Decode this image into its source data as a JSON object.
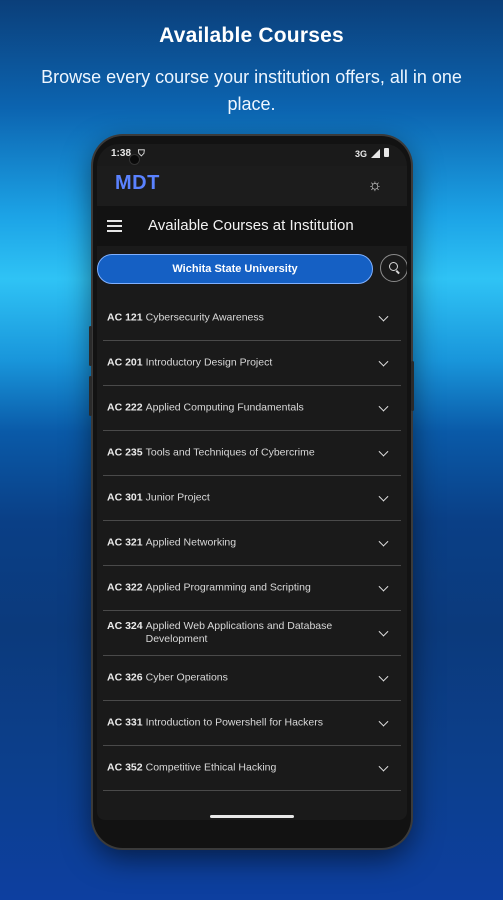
{
  "promo": {
    "title": "Available Courses",
    "subtitle": "Browse every course your institution offers, all in one place."
  },
  "status_bar": {
    "time": "1:38",
    "network": "3G"
  },
  "app_bar": {
    "brand": "MDT",
    "theme_icon": "sun-icon"
  },
  "header": {
    "menu_icon": "menu-icon",
    "title": "Available Courses at Institution"
  },
  "institution": {
    "selected": "Wichita State University"
  },
  "courses": [
    {
      "code": "AC 121",
      "name": "Cybersecurity Awareness"
    },
    {
      "code": "AC 201",
      "name": "Introductory Design Project"
    },
    {
      "code": "AC 222",
      "name": "Applied Computing Fundamentals"
    },
    {
      "code": "AC 235",
      "name": "Tools and Techniques of Cybercrime"
    },
    {
      "code": "AC 301",
      "name": "Junior Project"
    },
    {
      "code": "AC 321",
      "name": "Applied Networking"
    },
    {
      "code": "AC 322",
      "name": "Applied Programming and Scripting"
    },
    {
      "code": "AC 324",
      "name": "Applied Web Applications and Database Development"
    },
    {
      "code": "AC 326",
      "name": "Cyber Operations"
    },
    {
      "code": "AC 331",
      "name": "Introduction to Powershell for Hackers"
    },
    {
      "code": "AC 352",
      "name": "Competitive Ethical Hacking"
    }
  ],
  "colors": {
    "brand": "#5a82ff",
    "selector": "#1560c4",
    "background_top": "#0b3f7a",
    "background_mid": "#2fc3f5"
  }
}
